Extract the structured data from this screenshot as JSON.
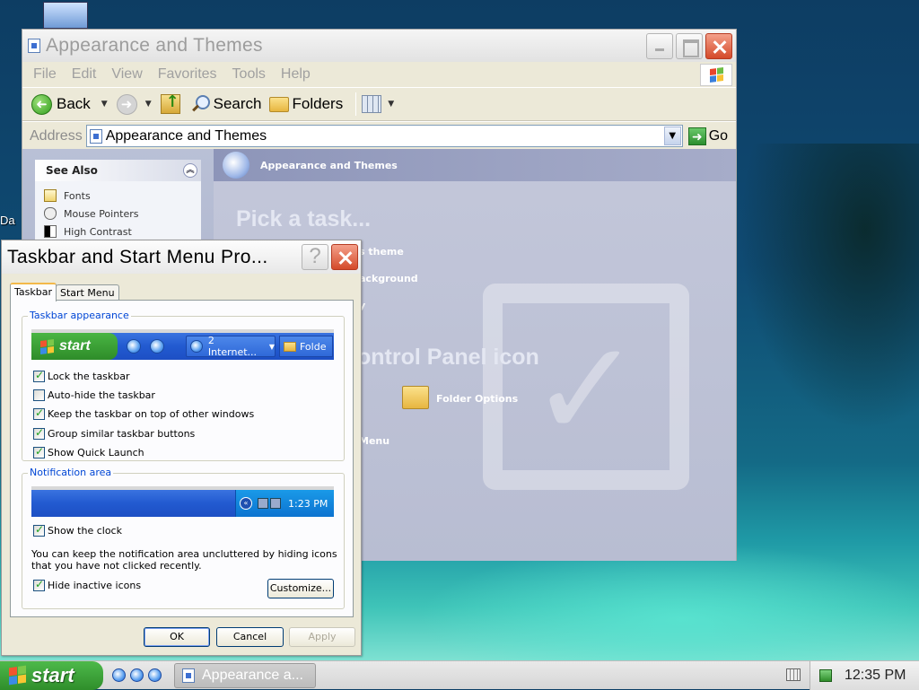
{
  "desktop": {
    "partial_text": "Da"
  },
  "explorer": {
    "title": "Appearance and Themes",
    "menu": [
      "File",
      "Edit",
      "View",
      "Favorites",
      "Tools",
      "Help"
    ],
    "toolbar": {
      "back": "Back",
      "search": "Search",
      "folders": "Folders"
    },
    "address": {
      "label": "Address",
      "value": "Appearance and Themes",
      "go": "Go"
    },
    "see_also": {
      "title": "See Also",
      "items": [
        "Fonts",
        "Mouse Pointers",
        "High Contrast"
      ]
    },
    "header": "Appearance and Themes",
    "pick_task": "Pick a task...",
    "task_fragments": [
      "s theme",
      "ackground",
      "y"
    ],
    "cp_heading_fragment": "ontrol Panel icon",
    "cp_item": "Folder Options",
    "menu_fragment": "Menu"
  },
  "dialog": {
    "title": "Taskbar and Start Menu Pro...",
    "tabs": [
      "Taskbar",
      "Start Menu"
    ],
    "appearance_group": "Taskbar appearance",
    "preview": {
      "start": "start",
      "task1": "2 Internet...",
      "task2": "Folde"
    },
    "options": [
      {
        "label": "Lock the taskbar",
        "checked": true
      },
      {
        "label": "Auto-hide the taskbar",
        "checked": false
      },
      {
        "label": "Keep the taskbar on top of other windows",
        "checked": true
      },
      {
        "label": "Group similar taskbar buttons",
        "checked": true
      },
      {
        "label": "Show Quick Launch",
        "checked": true
      }
    ],
    "notification_group": "Notification area",
    "notif_preview_time": "1:23 PM",
    "show_clock": {
      "label": "Show the clock",
      "checked": true
    },
    "info": "You can keep the notification area uncluttered by hiding icons that you have not clicked recently.",
    "hide_inactive": {
      "label": "Hide inactive icons",
      "checked": true
    },
    "customize": "Customize...",
    "buttons": {
      "ok": "OK",
      "cancel": "Cancel",
      "apply": "Apply"
    }
  },
  "taskbar": {
    "start": "start",
    "task": "Appearance a...",
    "clock": "12:35 PM"
  }
}
